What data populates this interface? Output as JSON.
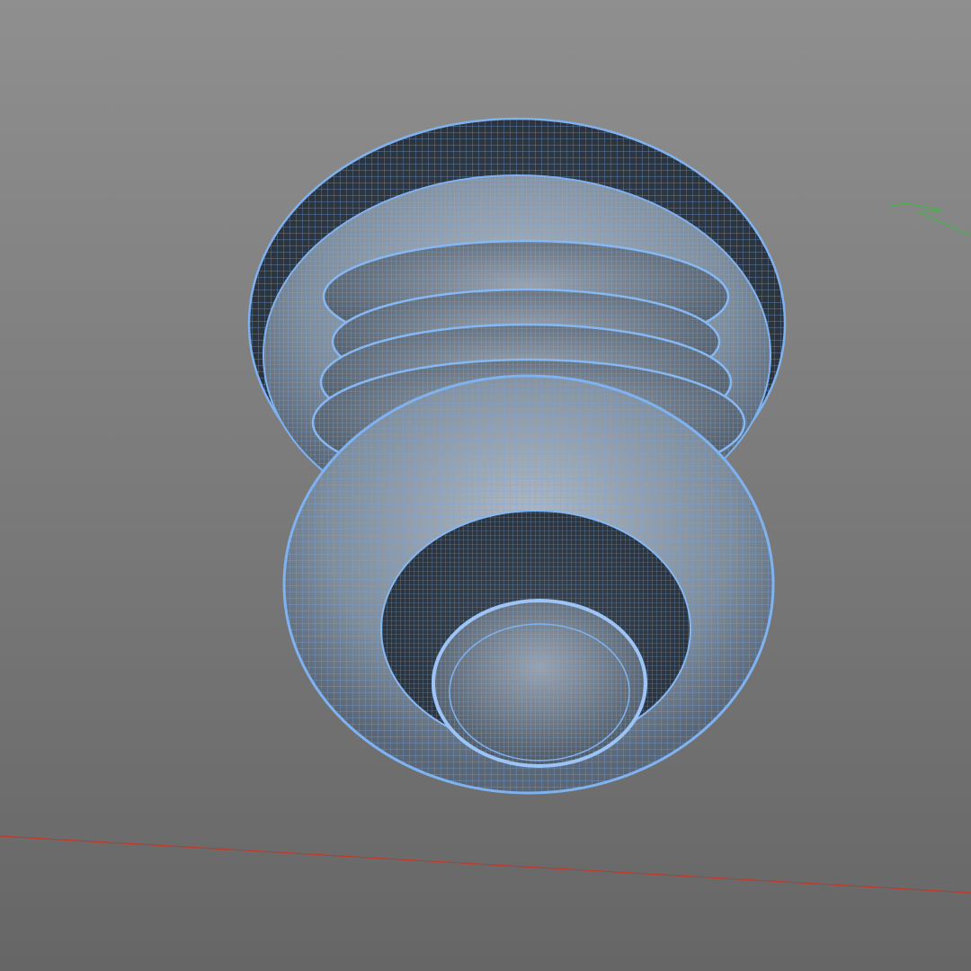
{
  "viewport": {
    "background_top": "#8f8f8f",
    "background_bottom": "#666666"
  },
  "model": {
    "wire_color": "#6fa6ec",
    "wire_dark": "#3a6fb5",
    "body_color": "#8d9aa8",
    "selected": true
  },
  "axes": {
    "x_color": "#c0392b",
    "y_color": "#4caf50"
  }
}
